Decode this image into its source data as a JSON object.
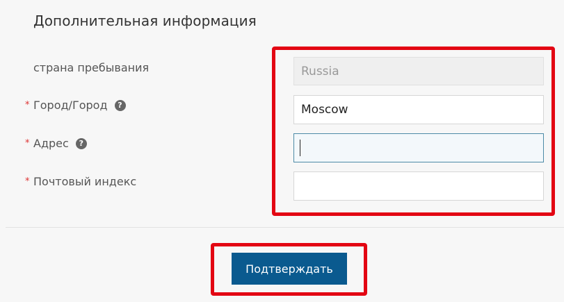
{
  "section": {
    "title": "Дополнительная информация"
  },
  "form": {
    "country": {
      "label": "страна пребывания",
      "value": "Russia"
    },
    "city": {
      "required_mark": "*",
      "label": "Город/Город",
      "value": "Moscow",
      "help_glyph": "?"
    },
    "address": {
      "required_mark": "*",
      "label": "Адрес",
      "value": "",
      "help_glyph": "?"
    },
    "postal": {
      "required_mark": "*",
      "label": "Почтовый индекс",
      "value": ""
    }
  },
  "actions": {
    "submit_label": "Подтверждать"
  },
  "colors": {
    "highlight": "#e30613",
    "primary_button": "#0a5a8f",
    "required_asterisk": "#d33"
  },
  "icons": {
    "help": "question-circle-icon"
  }
}
